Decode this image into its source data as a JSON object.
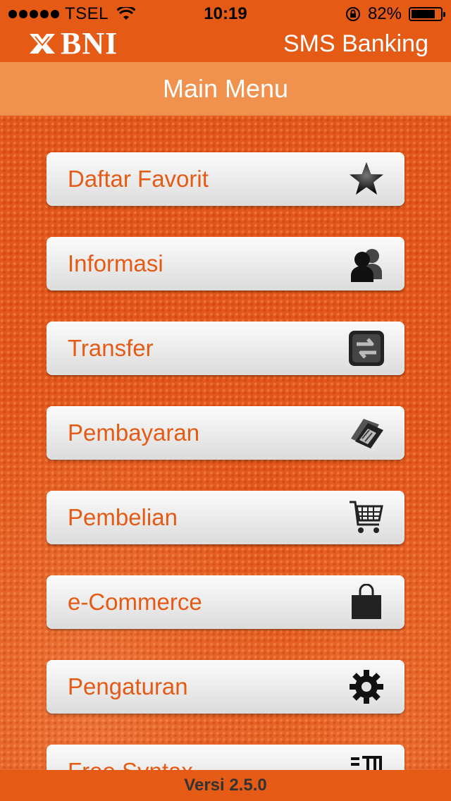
{
  "status_bar": {
    "carrier": "TSEL",
    "time": "10:19",
    "battery": "82%",
    "battery_level": 0.82
  },
  "header": {
    "logo_text": "BNI",
    "app_name": "SMS Banking"
  },
  "title": "Main Menu",
  "menu": [
    {
      "label": "Daftar Favorit",
      "icon": "star-icon"
    },
    {
      "label": "Informasi",
      "icon": "users-icon"
    },
    {
      "label": "Transfer",
      "icon": "transfer-icon"
    },
    {
      "label": "Pembayaran",
      "icon": "payment-card-icon"
    },
    {
      "label": "Pembelian",
      "icon": "shopping-cart-icon"
    },
    {
      "label": "e-Commerce",
      "icon": "shopping-bag-icon"
    },
    {
      "label": "Pengaturan",
      "icon": "gear-icon"
    },
    {
      "label": "Free Syntax",
      "icon": "syntax-icon"
    }
  ],
  "footer": {
    "version": "Versi 2.5.0"
  },
  "colors": {
    "brand_orange": "#e55a14",
    "title_bar": "#f0924e",
    "button_text": "#e55a14"
  }
}
